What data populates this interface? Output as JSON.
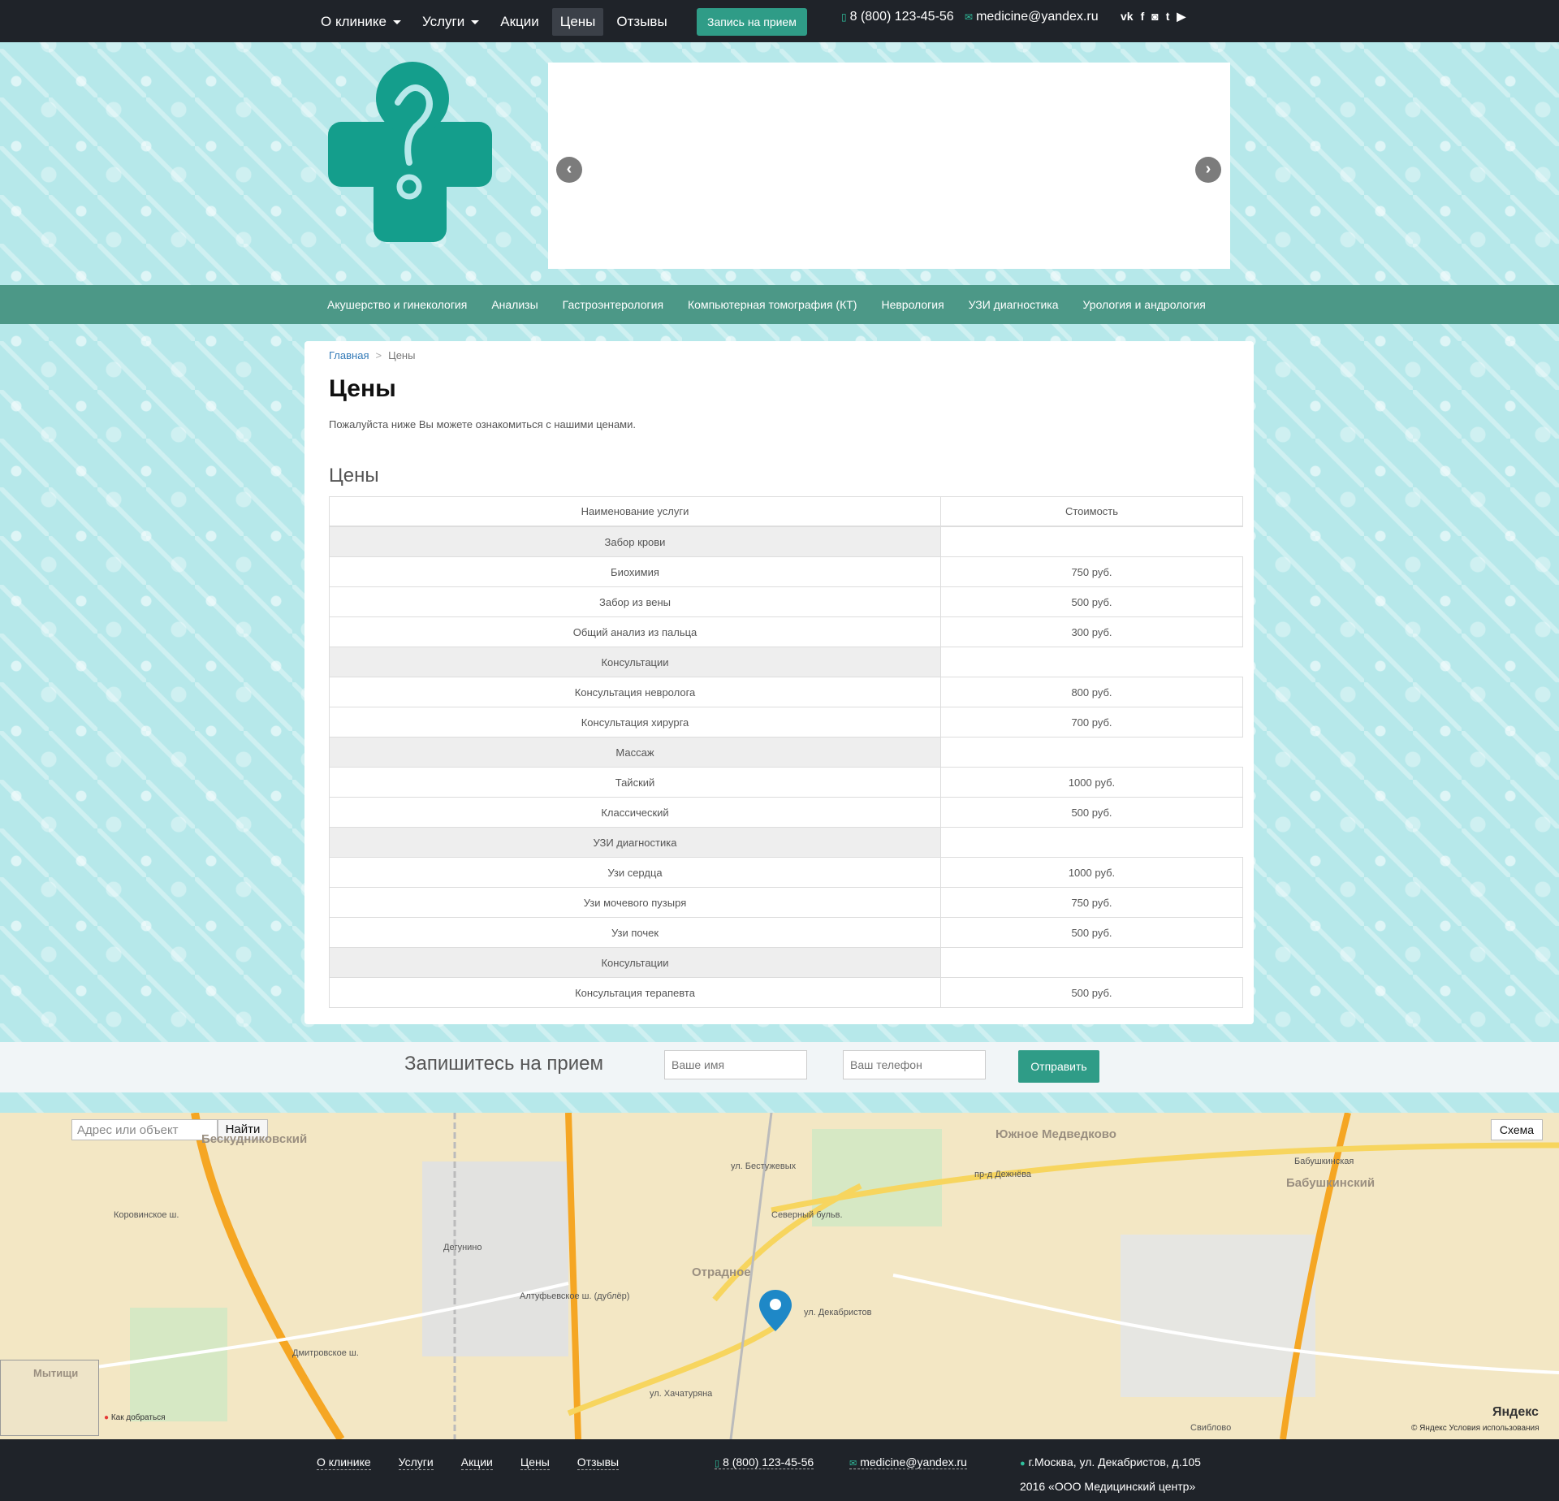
{
  "topbar": {
    "nav": [
      {
        "label": "О клинике",
        "dropdown": true
      },
      {
        "label": "Услуги",
        "dropdown": true
      },
      {
        "label": "Акции",
        "dropdown": false
      },
      {
        "label": "Цены",
        "dropdown": false,
        "active": true
      },
      {
        "label": "Отзывы",
        "dropdown": false
      }
    ],
    "appointment_button": "Запись на прием",
    "phone": "8 (800) 123-45-56",
    "email": "medicine@yandex.ru",
    "social": [
      "vk-icon",
      "facebook-icon",
      "instagram-icon",
      "twitter-icon",
      "youtube-icon"
    ]
  },
  "services_nav": [
    "Акушерство и гинекология",
    "Анализы",
    "Гастроэнтерология",
    "Компьютерная томография (КТ)",
    "Неврология",
    "УЗИ диагностика",
    "Урология и андрология"
  ],
  "breadcrumb": {
    "home": "Главная",
    "current": "Цены"
  },
  "page": {
    "title": "Цены",
    "lead": "Пожалуйста ниже Вы можете ознакомиться с нашими ценами.",
    "section_title": "Цены"
  },
  "table": {
    "headers": [
      "Наименование услуги",
      "Стоимость"
    ],
    "rows": [
      {
        "name": "Забор крови",
        "price": "",
        "category": true
      },
      {
        "name": "Биохимия",
        "price": "750 руб.",
        "category": false
      },
      {
        "name": "Забор из вены",
        "price": "500 руб.",
        "category": false
      },
      {
        "name": "Общий анализ из пальца",
        "price": "300 руб.",
        "category": false
      },
      {
        "name": "Консультации",
        "price": "",
        "category": true
      },
      {
        "name": "Консультация невролога",
        "price": "800 руб.",
        "category": false
      },
      {
        "name": "Консультация хирурга",
        "price": "700 руб.",
        "category": false
      },
      {
        "name": "Массаж",
        "price": "",
        "category": true
      },
      {
        "name": "Тайский",
        "price": "1000 руб.",
        "category": false
      },
      {
        "name": "Классический",
        "price": "500 руб.",
        "category": false
      },
      {
        "name": "УЗИ диагностика",
        "price": "",
        "category": true
      },
      {
        "name": "Узи сердца",
        "price": "1000 руб.",
        "category": false
      },
      {
        "name": "Узи мочевого пузыря",
        "price": "750 руб.",
        "category": false
      },
      {
        "name": "Узи почек",
        "price": "500 руб.",
        "category": false
      },
      {
        "name": "Консультации",
        "price": "",
        "category": true
      },
      {
        "name": "Консультация терапевта",
        "price": "500 руб.",
        "category": false
      }
    ]
  },
  "appointment": {
    "title": "Запишитесь на прием",
    "name_placeholder": "Ваше имя",
    "phone_placeholder": "Ваш телефон",
    "submit": "Отправить"
  },
  "map": {
    "search_placeholder": "Адрес или объект",
    "find_button": "Найти",
    "scheme_button": "Схема",
    "route_link": "Как добраться",
    "terms": "© Яндекс  Условия использования",
    "logo": "Яндекс",
    "districts": [
      "Бескудниковский",
      "Южное Медведково",
      "Отрадное",
      "Бабушкинский",
      "Мытищи"
    ],
    "streets": [
      "Коровинское ш.",
      "Дмитровское ш.",
      "Северный бульв.",
      "пр-д Дежнёва",
      "ул. Хачатуряна",
      "ул. Декабристов",
      "Алтуфьевское ш. (дублёр)",
      "ул. Бестужевых",
      "Бабушкинская",
      "Свиблово",
      "Дегунино"
    ]
  },
  "footer": {
    "nav": [
      "О клинике",
      "Услуги",
      "Акции",
      "Цены",
      "Отзывы"
    ],
    "phone": "8 (800) 123-45-56",
    "email": "medicine@yandex.ru",
    "address": "г.Москва, ул. Декабристов, д.105",
    "copyright": "2016 «ООО Медицинский центр»"
  },
  "colors": {
    "topbar": "#1f2329",
    "accent": "#2f9c87",
    "services_bar": "#4c9887",
    "background": "#b6e8ea",
    "logo": "#149e8c"
  }
}
